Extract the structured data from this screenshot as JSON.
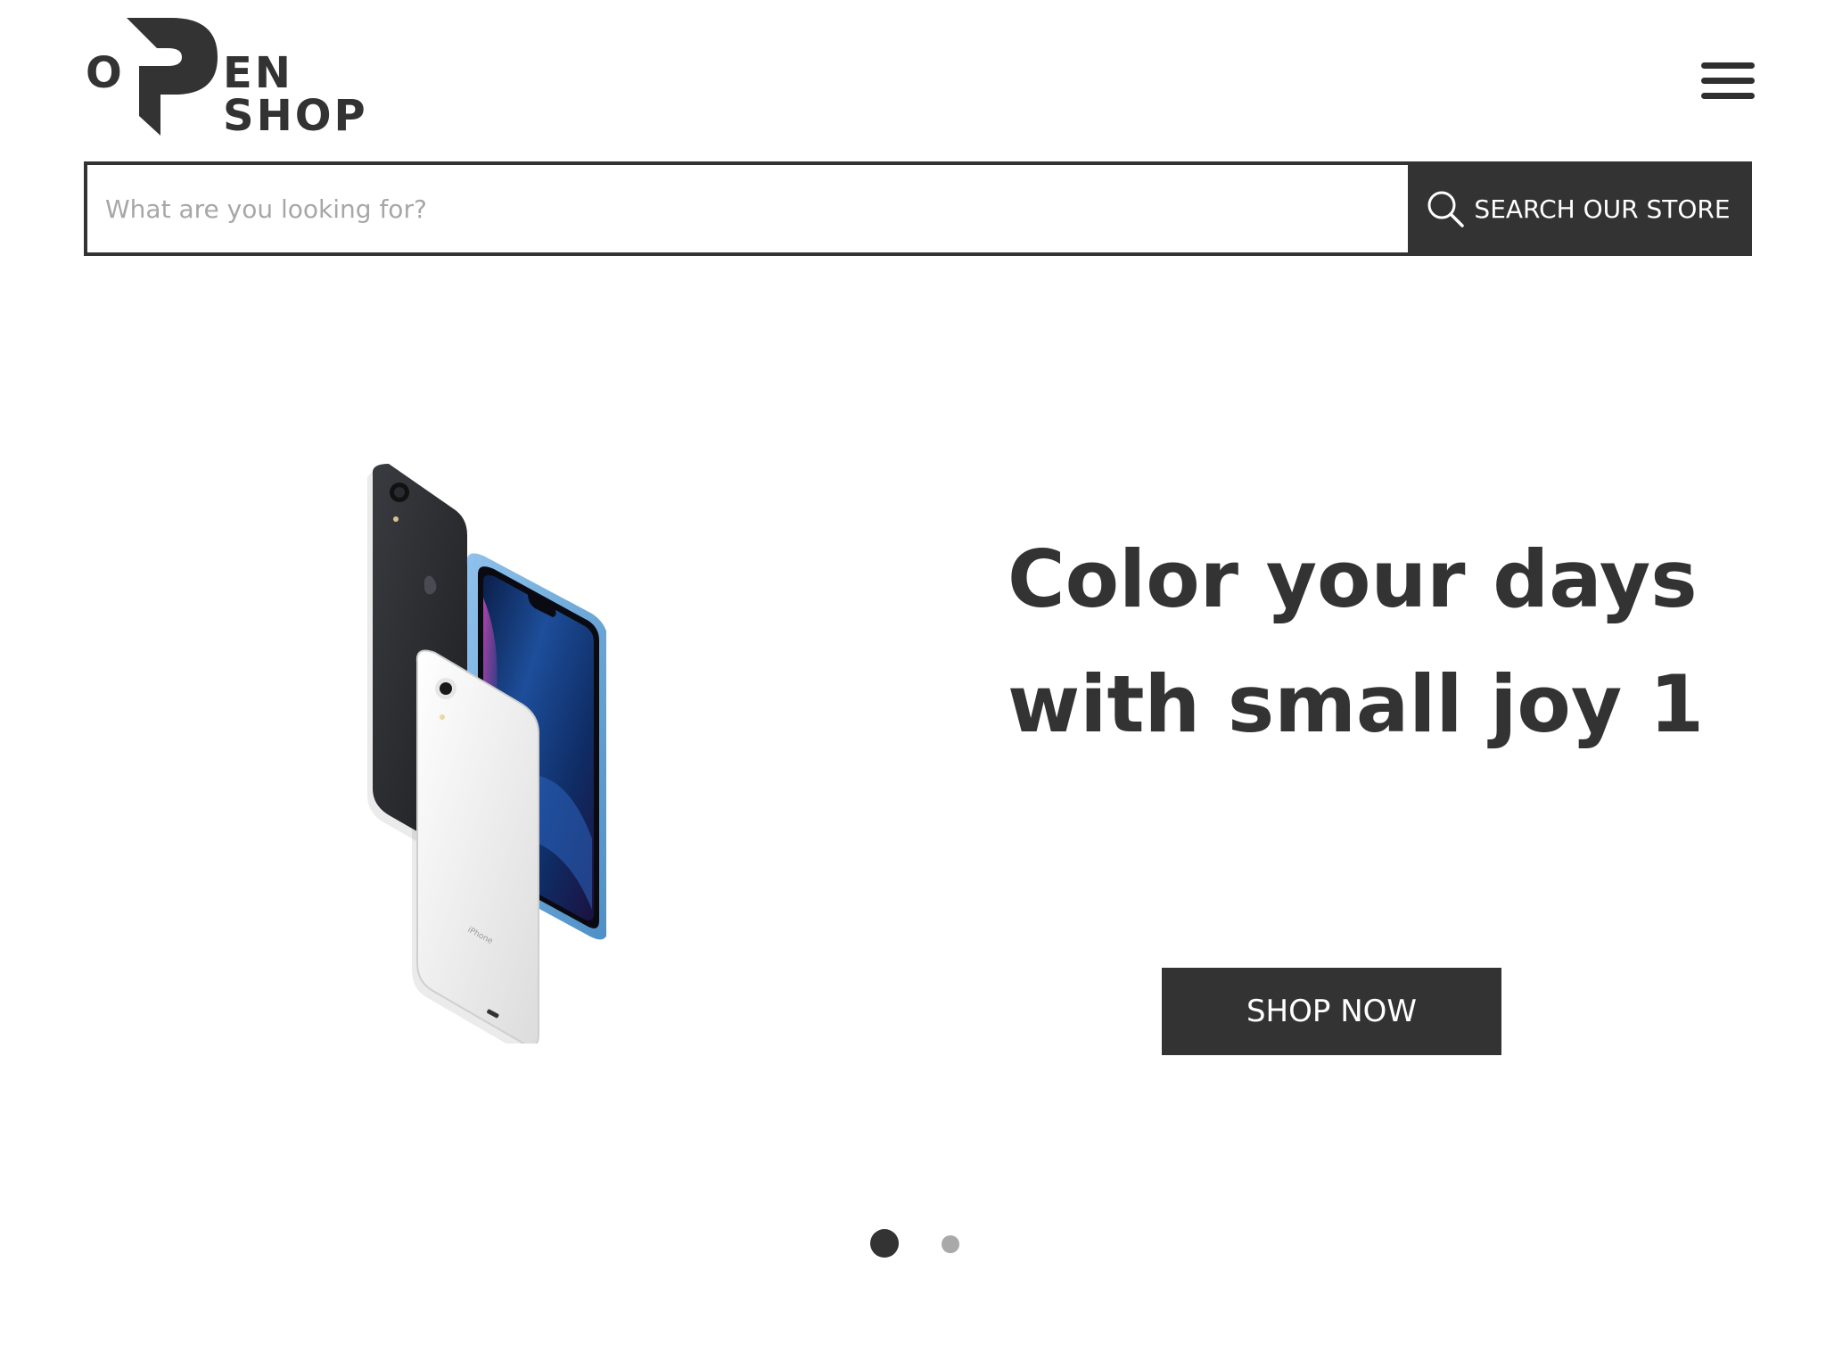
{
  "header": {
    "logo": {
      "letter_left": "O",
      "text_right": "EN SHOP",
      "full_name": "OPEN SHOP"
    },
    "menu_icon": "hamburger-menu-icon"
  },
  "search": {
    "placeholder": "What are you looking for?",
    "button_label": "SEARCH OUR STORE",
    "button_icon": "search-icon"
  },
  "hero": {
    "headline": "Color your days with small joy 1",
    "button_label": "SHOP NOW",
    "image": "three-smartphones-image"
  },
  "slider": {
    "total_slides": 2,
    "active_slide": 1
  },
  "colors": {
    "primary_dark": "#333333",
    "background": "#ffffff",
    "placeholder_text": "#a7a7a7",
    "inactive_dot": "#a9a9a9"
  }
}
